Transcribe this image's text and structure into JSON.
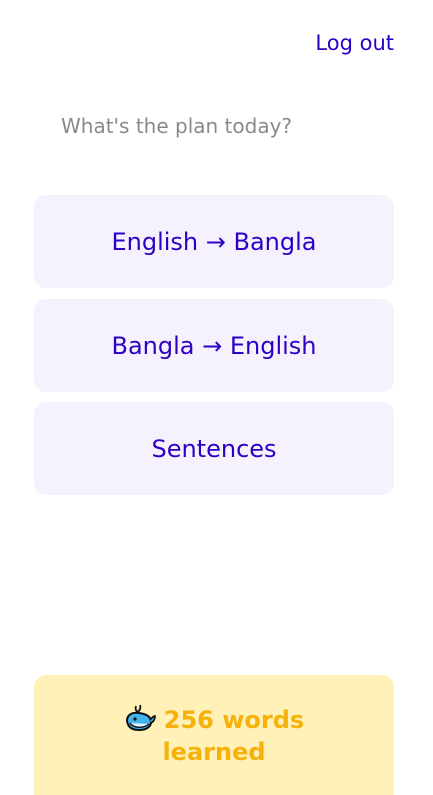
{
  "header": {
    "logout_label": "Log out"
  },
  "prompt": {
    "text": "What's the plan today?"
  },
  "options": [
    {
      "label": "English → Bangla"
    },
    {
      "label": "Bangla → English"
    },
    {
      "label": "Sentences"
    }
  ],
  "progress": {
    "icon": "whale-icon",
    "line1": "256 words",
    "line2": "learned"
  },
  "colors": {
    "accent": "#2f00c4",
    "card_bg": "#f5f2fd",
    "progress_bg": "#fff1b8",
    "progress_text": "#f6b10b",
    "muted_text": "#8a8a8a"
  }
}
